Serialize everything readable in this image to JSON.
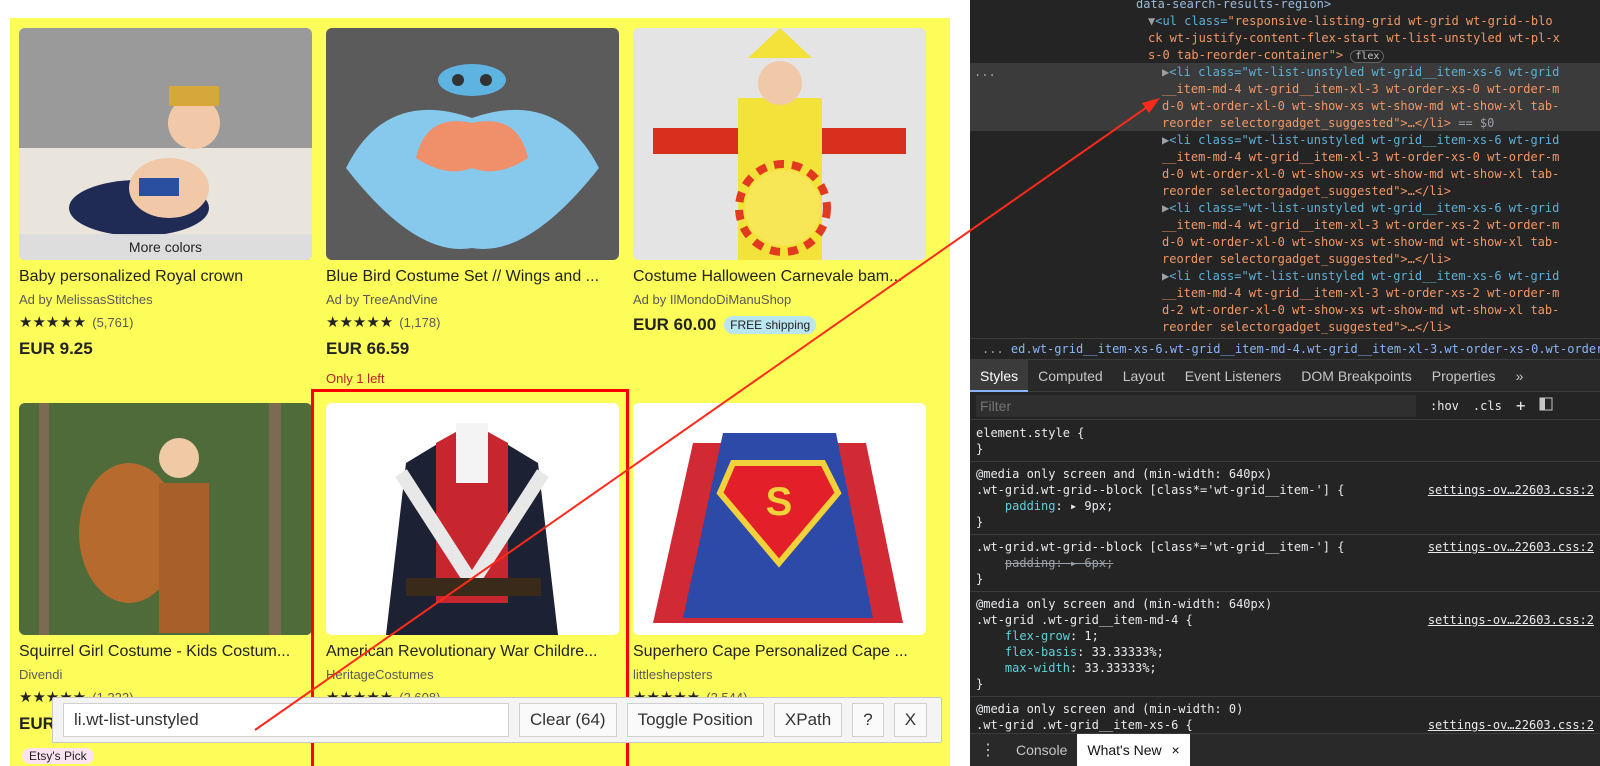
{
  "listings": [
    {
      "title": "Baby personalized Royal crown",
      "seller": "Ad by MelissasStitches",
      "rating_count": "(5,761)",
      "price": "EUR 9.25",
      "overlay": "More colors"
    },
    {
      "title": "Blue Bird Costume Set // Wings and ...",
      "seller": "Ad by TreeAndVine",
      "rating_count": "(1,178)",
      "price": "EUR 66.59",
      "stock": "Only 1 left"
    },
    {
      "title": "Costume Halloween Carnevale bam...",
      "seller": "Ad by IlMondoDiManuShop",
      "price": "EUR 60.00",
      "shipping": "FREE shipping"
    },
    {
      "title": "Squirrel Girl Costume - Kids Costum...",
      "seller": "Divendi",
      "rating_count": "(1,222)",
      "price": "EUR",
      "badge": "Etsy's Pick"
    },
    {
      "title": "American Revolutionary War Childre...",
      "seller": "HeritageCostumes",
      "rating_count": "(2,608)"
    },
    {
      "title": "Superhero Cape Personalized Cape ...",
      "seller": "littleshepsters",
      "rating_count": "(2,544)"
    }
  ],
  "stars": "★★★★★",
  "gadget": {
    "input_value": "li.wt-list-unstyled",
    "clear_label": "Clear (64)",
    "toggle_label": "Toggle Position",
    "xpath_label": "XPath",
    "help_label": "?",
    "close_label": "X"
  },
  "devtools": {
    "dom_lines": {
      "l0": "data-search-results-region>",
      "ul_open": "<ul class=",
      "ul_class_1": "\"responsive-listing-grid wt-grid wt-grid--blo",
      "ul_class_2": "ck wt-justify-content-flex-start wt-list-unstyled wt-pl-x",
      "ul_class_3": "s-0 tab-reorder-container\">",
      "flex_badge": "flex",
      "li1_a": "<li class=\"wt-list-unstyled wt-grid__item-xs-6 wt-grid",
      "li1_b": "__item-md-4 wt-grid__item-xl-3 wt-order-xs-0 wt-order-m",
      "li1_c": "d-0 wt-order-xl-0 wt-show-xs wt-show-md wt-show-xl tab-",
      "li1_d": "reorder selectorgadget_suggested\">…</li>",
      "li1_eq": " == $0",
      "li2_a": "<li class=\"wt-list-unstyled wt-grid__item-xs-6 wt-grid",
      "li2_b": "__item-md-4 wt-grid__item-xl-3 wt-order-xs-0 wt-order-m",
      "li2_c": "d-0 wt-order-xl-0 wt-show-xs wt-show-md wt-show-xl tab-",
      "li2_d": "reorder selectorgadget_suggested\">…</li>",
      "li3_a": "<li class=\"wt-list-unstyled wt-grid__item-xs-6 wt-grid",
      "li3_b": "__item-md-4 wt-grid__item-xl-3 wt-order-xs-2 wt-order-m",
      "li3_c": "d-0 wt-order-xl-0 wt-show-xs wt-show-md wt-show-xl tab-",
      "li3_d": "reorder selectorgadget_suggested\">…</li>",
      "li4_a": "<li class=\"wt-list-unstyled wt-grid__item-xs-6 wt-grid",
      "li4_b": "__item-md-4 wt-grid__item-xl-3 wt-order-xs-2 wt-order-m",
      "li4_c": "d-2 wt-order-xl-0 wt-show-xs wt-show-md wt-show-xl tab-",
      "li4_d": "reorder selectorgadget_suggested\">…</li>",
      "dots": "..."
    },
    "breadcrumb": "ed.wt-grid__item-xs-6.wt-grid__item-md-4.wt-grid__item-xl-3.wt-order-xs-0.wt-order-md-0.w",
    "breadcrumb_dots": "...",
    "tabs": [
      "Styles",
      "Computed",
      "Layout",
      "Event Listeners",
      "DOM Breakpoints",
      "Properties",
      "»"
    ],
    "filter_placeholder": "Filter",
    "hov": ":hov",
    "cls": ".cls",
    "plus": "+",
    "styles": {
      "r0_sel": "element.style {",
      "close": "}",
      "r1_media": "@media only screen and (min-width: 640px)",
      "r1_sel": ".wt-grid.wt-grid--block [class*='wt-grid__item-'] {",
      "r1_src": "settings-ov…22603.css:2",
      "r1_prop": "padding",
      "r1_val": "9px;",
      "r2_sel": ".wt-grid.wt-grid--block [class*='wt-grid__item-'] {",
      "r2_src": "settings-ov…22603.css:2",
      "r2_prop": "padding",
      "r2_val": "6px;",
      "r3_media": "@media only screen and (min-width: 640px)",
      "r3_sel": ".wt-grid .wt-grid__item-md-4 {",
      "r3_src": "settings-ov…22603.css:2",
      "r3_p1": "flex-grow",
      "r3_v1": "1;",
      "r3_p2": "flex-basis",
      "r3_v2": "33.33333%;",
      "r3_p3": "max-width",
      "r3_v3": "33.33333%;",
      "r4_media": "@media only screen and (min-width: 0)",
      "r4_sel": ".wt-grid .wt-grid__item-xs-6 {",
      "r4_src": "settings-ov…22603.css:2"
    },
    "drawer_tabs": [
      "Console",
      "What's New"
    ],
    "drawer_close": "×",
    "drawer_menu": "⋮"
  },
  "colors": {
    "highlight": "#fdfd5a",
    "selection_box": "#ff0000",
    "arrow": "#ff2a1a"
  }
}
